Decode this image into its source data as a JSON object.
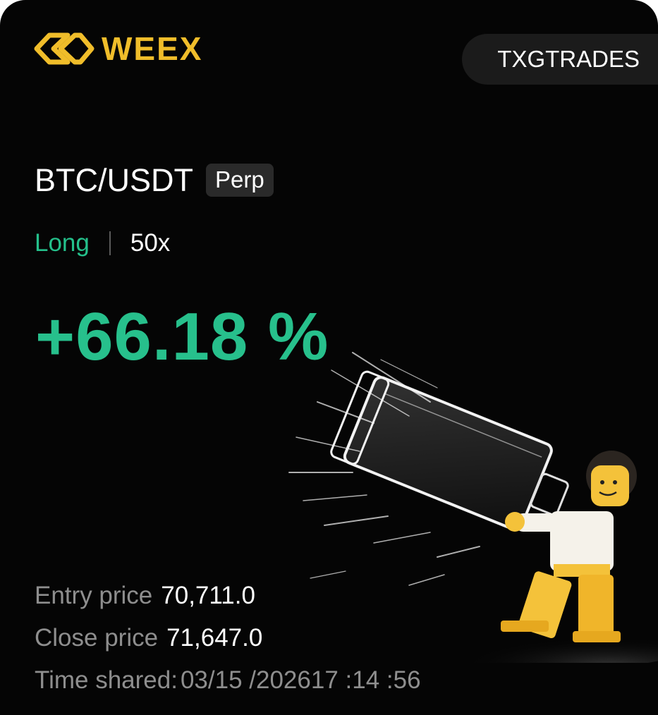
{
  "brand": {
    "name": "WEEX",
    "color": "#f0bd2a",
    "logo_icon": "weex-diamond-icon"
  },
  "user": {
    "handle": "TXGTRADES"
  },
  "position": {
    "pair": "BTC/USDT",
    "type_badge": "Perp",
    "side": "Long",
    "side_color": "#24c08b",
    "leverage": "50x",
    "pnl_percent": "+66.18 %"
  },
  "stats": {
    "entry_label": "Entry price",
    "entry_value": "70,711.0",
    "close_label": "Close price",
    "close_value": "71,647.0",
    "time_label": "Time shared:",
    "time_value": "03/15 /202617 :14 :56"
  },
  "illustration": {
    "icon": "toy-figure-with-glass-bottle-illustration"
  }
}
